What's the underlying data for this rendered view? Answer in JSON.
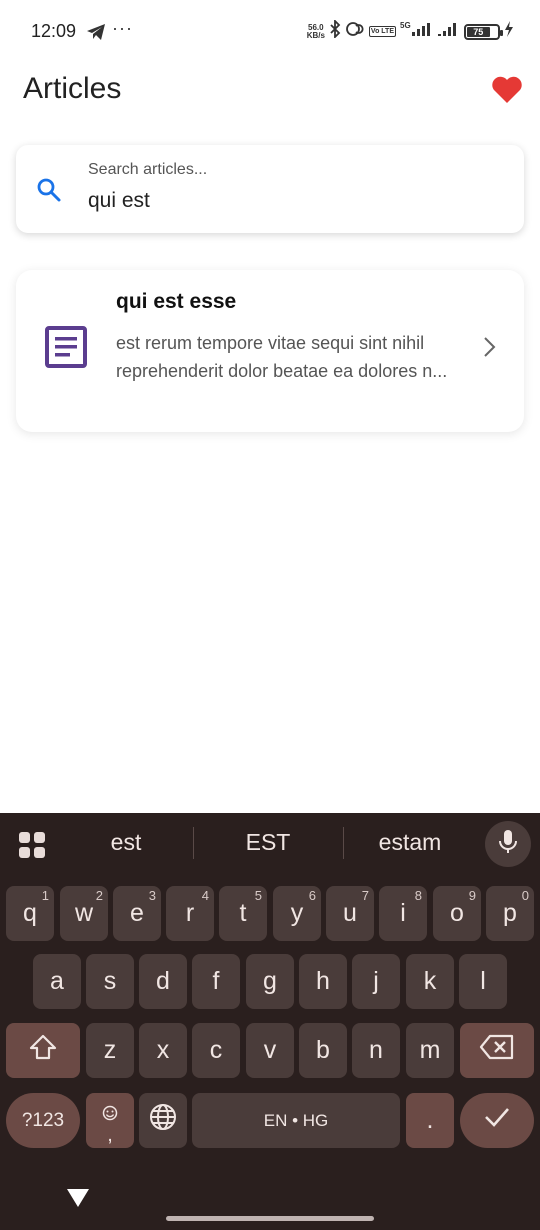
{
  "status_bar": {
    "time": "12:09",
    "more": "···",
    "net_speed_value": "56.0",
    "net_speed_unit": "KB/s",
    "volte": "Vo LTE",
    "network": "5G",
    "battery": "75"
  },
  "app_bar": {
    "title": "Articles"
  },
  "search": {
    "label": "Search articles...",
    "value": "qui est"
  },
  "articles": [
    {
      "title": "qui est esse",
      "excerpt": "est rerum tempore vitae sequi sint nihil reprehenderit dolor beatae ea dolores n..."
    }
  ],
  "keyboard": {
    "suggestions": [
      "est",
      "EST",
      "estam"
    ],
    "row1": [
      {
        "letter": "q",
        "num": "1"
      },
      {
        "letter": "w",
        "num": "2"
      },
      {
        "letter": "e",
        "num": "3"
      },
      {
        "letter": "r",
        "num": "4"
      },
      {
        "letter": "t",
        "num": "5"
      },
      {
        "letter": "y",
        "num": "6"
      },
      {
        "letter": "u",
        "num": "7"
      },
      {
        "letter": "i",
        "num": "8"
      },
      {
        "letter": "o",
        "num": "9"
      },
      {
        "letter": "p",
        "num": "0"
      }
    ],
    "row2": [
      "a",
      "s",
      "d",
      "f",
      "g",
      "h",
      "j",
      "k",
      "l"
    ],
    "row3": [
      "z",
      "x",
      "c",
      "v",
      "b",
      "n",
      "m"
    ],
    "symbols_label": "?123",
    "emoji_comma": ",",
    "space_label": "EN • HG",
    "period": "."
  },
  "colors": {
    "accent_blue": "#1a73e8",
    "heart_red": "#e53935",
    "article_icon_purple": "#5b3d8f",
    "keyboard_bg": "#2a1f1e"
  }
}
